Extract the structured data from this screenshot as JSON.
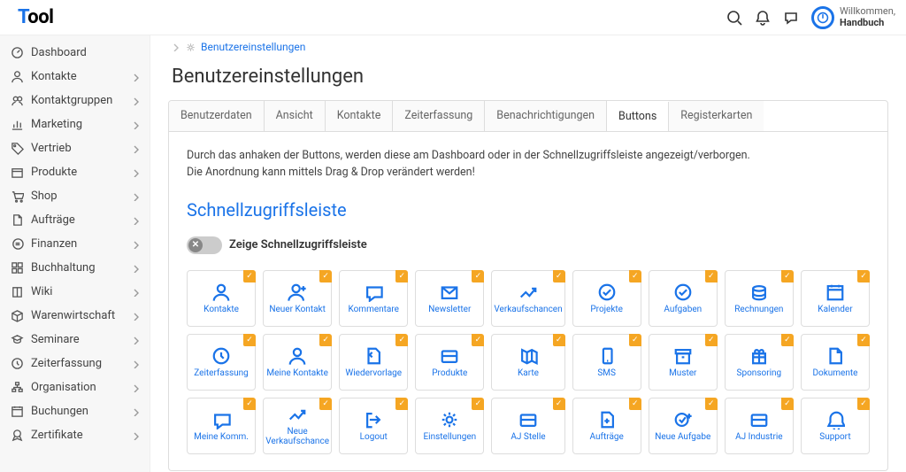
{
  "app": {
    "logo_t": "T",
    "logo_rest": "ool"
  },
  "user": {
    "welcome": "Willkommen,",
    "name": "Handbuch"
  },
  "sidebar": {
    "items": [
      {
        "label": "Dashboard",
        "icon": "gauge",
        "expandable": false
      },
      {
        "label": "Kontakte",
        "icon": "person",
        "expandable": true
      },
      {
        "label": "Kontaktgruppen",
        "icon": "people",
        "expandable": true
      },
      {
        "label": "Marketing",
        "icon": "chart",
        "expandable": true
      },
      {
        "label": "Vertrieb",
        "icon": "tag",
        "expandable": true
      },
      {
        "label": "Produkte",
        "icon": "box",
        "expandable": true
      },
      {
        "label": "Shop",
        "icon": "cart",
        "expandable": true
      },
      {
        "label": "Aufträge",
        "icon": "doc",
        "expandable": true
      },
      {
        "label": "Finanzen",
        "icon": "euro",
        "expandable": true
      },
      {
        "label": "Buchhaltung",
        "icon": "grid",
        "expandable": true
      },
      {
        "label": "Wiki",
        "icon": "book",
        "expandable": true
      },
      {
        "label": "Warenwirtschaft",
        "icon": "package",
        "expandable": true
      },
      {
        "label": "Seminare",
        "icon": "cap",
        "expandable": true
      },
      {
        "label": "Zeiterfassung",
        "icon": "clock",
        "expandable": true
      },
      {
        "label": "Organisation",
        "icon": "org",
        "expandable": true
      },
      {
        "label": "Buchungen",
        "icon": "calendar",
        "expandable": true
      },
      {
        "label": "Zertifikate",
        "icon": "ribbon",
        "expandable": true
      }
    ]
  },
  "breadcrumb": {
    "current": "Benutzereinstellungen"
  },
  "page": {
    "title": "Benutzereinstellungen"
  },
  "tabs": [
    {
      "label": "Benutzerdaten"
    },
    {
      "label": "Ansicht"
    },
    {
      "label": "Kontakte"
    },
    {
      "label": "Zeiterfassung"
    },
    {
      "label": "Benachrichtigungen"
    },
    {
      "label": "Buttons",
      "active": true
    },
    {
      "label": "Registerkarten"
    }
  ],
  "hint": {
    "line1": "Durch das anhaken der Buttons, werden diese am Dashboard oder in der Schnellzugriffsleiste angezeigt/verborgen.",
    "line2": "Die Anordnung kann mittels Drag & Drop verändert werden!"
  },
  "section": {
    "quickbar_title": "Schnellzugriffsleiste"
  },
  "toggle": {
    "label": "Zeige Schnellzugriffsleiste",
    "on": false
  },
  "tiles": [
    {
      "label": "Kontakte",
      "icon": "person",
      "checked": true
    },
    {
      "label": "Neuer Kontakt",
      "icon": "personplus",
      "checked": true
    },
    {
      "label": "Kommentare",
      "icon": "chat",
      "checked": true
    },
    {
      "label": "Newsletter",
      "icon": "mail",
      "checked": true
    },
    {
      "label": "Verkaufschancen",
      "icon": "trend",
      "checked": true
    },
    {
      "label": "Projekte",
      "icon": "target",
      "checked": true
    },
    {
      "label": "Aufgaben",
      "icon": "check",
      "checked": true
    },
    {
      "label": "Rechnungen",
      "icon": "coins",
      "checked": true
    },
    {
      "label": "Kalender",
      "icon": "calendar",
      "checked": true
    },
    {
      "label": "Zeiterfassung",
      "icon": "clock",
      "checked": true
    },
    {
      "label": "Meine Kontakte",
      "icon": "person",
      "checked": true
    },
    {
      "label": "Wiedervorlage",
      "icon": "docback",
      "checked": true
    },
    {
      "label": "Produkte",
      "icon": "card",
      "checked": true
    },
    {
      "label": "Karte",
      "icon": "map",
      "checked": true
    },
    {
      "label": "SMS",
      "icon": "phone",
      "checked": true
    },
    {
      "label": "Muster",
      "icon": "archive",
      "checked": true
    },
    {
      "label": "Sponsoring",
      "icon": "gift",
      "checked": true
    },
    {
      "label": "Dokumente",
      "icon": "doc",
      "checked": true
    },
    {
      "label": "Meine Komm.",
      "icon": "chat",
      "checked": true
    },
    {
      "label": "Neue Verkaufschance",
      "icon": "trend",
      "checked": true
    },
    {
      "label": "Logout",
      "icon": "logout",
      "checked": true
    },
    {
      "label": "Einstellungen",
      "icon": "gear",
      "checked": true
    },
    {
      "label": "AJ Stelle",
      "icon": "card",
      "checked": true
    },
    {
      "label": "Aufträge",
      "icon": "docplus",
      "checked": true
    },
    {
      "label": "Neue Aufgabe",
      "icon": "checkplus",
      "checked": true
    },
    {
      "label": "AJ Industrie",
      "icon": "card",
      "checked": true
    },
    {
      "label": "Support",
      "icon": "bell",
      "checked": true
    }
  ]
}
